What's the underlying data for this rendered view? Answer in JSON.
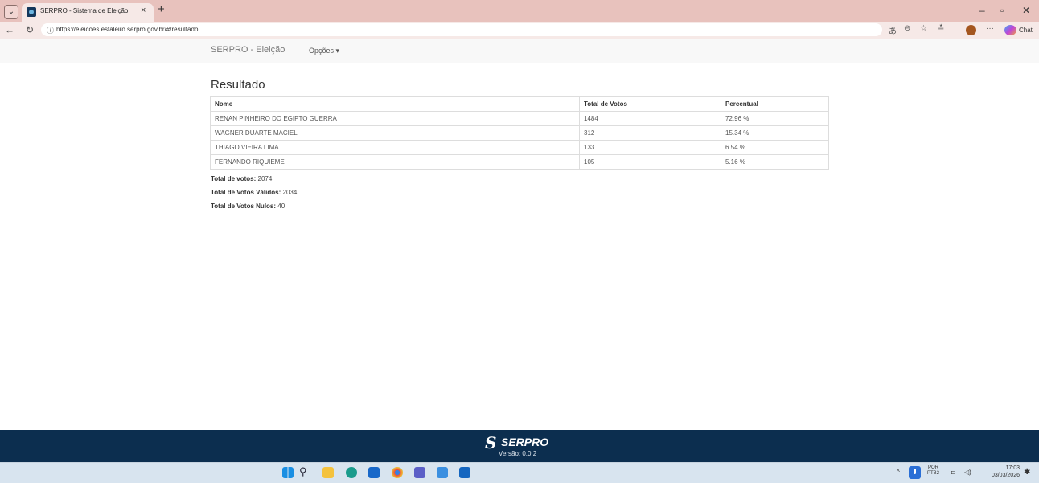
{
  "browser": {
    "tab_list_icon": "⌄",
    "tab_title": "SERPRO - Sistema de Eleição",
    "tab_close": "×",
    "new_tab": "+",
    "minimize": "–",
    "restore": "▫",
    "close": "✕",
    "url": "https://eleicoes.estaleiro.serpro.gov.br/#/resultado",
    "chat_label": "Chat"
  },
  "navbar": {
    "brand": "SERPRO - Eleição",
    "options_label": "Opções ▾"
  },
  "main": {
    "title": "Resultado",
    "columns": [
      "Nome",
      "Total de Votos",
      "Percentual"
    ],
    "rows": [
      {
        "nome": "RENAN PINHEIRO DO EGIPTO GUERRA",
        "votos": "1484",
        "percentual": "72.96 %"
      },
      {
        "nome": "WAGNER DUARTE MACIEL",
        "votos": "312",
        "percentual": "15.34 %"
      },
      {
        "nome": "THIAGO VIEIRA LIMA",
        "votos": "133",
        "percentual": "6.54 %"
      },
      {
        "nome": "FERNANDO RIQUIEME",
        "votos": "105",
        "percentual": "5.16 %"
      }
    ],
    "summary": {
      "total_label": "Total de votos:",
      "total_value": " 2074",
      "validos_label": "Total de Votos Válidos:",
      "validos_value": " 2034",
      "nulos_label": "Total de Votos Nulos:",
      "nulos_value": " 40"
    }
  },
  "footer": {
    "logo_text": "SERPRO",
    "version": "Versão: 0.0.2"
  },
  "taskbar": {
    "lang_line1": "POR",
    "lang_line2": "PTB2",
    "time": "17:03",
    "date": "03/03/2026",
    "icons": [
      "windows-start-icon",
      "search-icon",
      "file-explorer-icon",
      "edge-icon",
      "store-icon",
      "chrome-icon",
      "teams-icon",
      "photos-icon",
      "outlook-icon"
    ]
  }
}
